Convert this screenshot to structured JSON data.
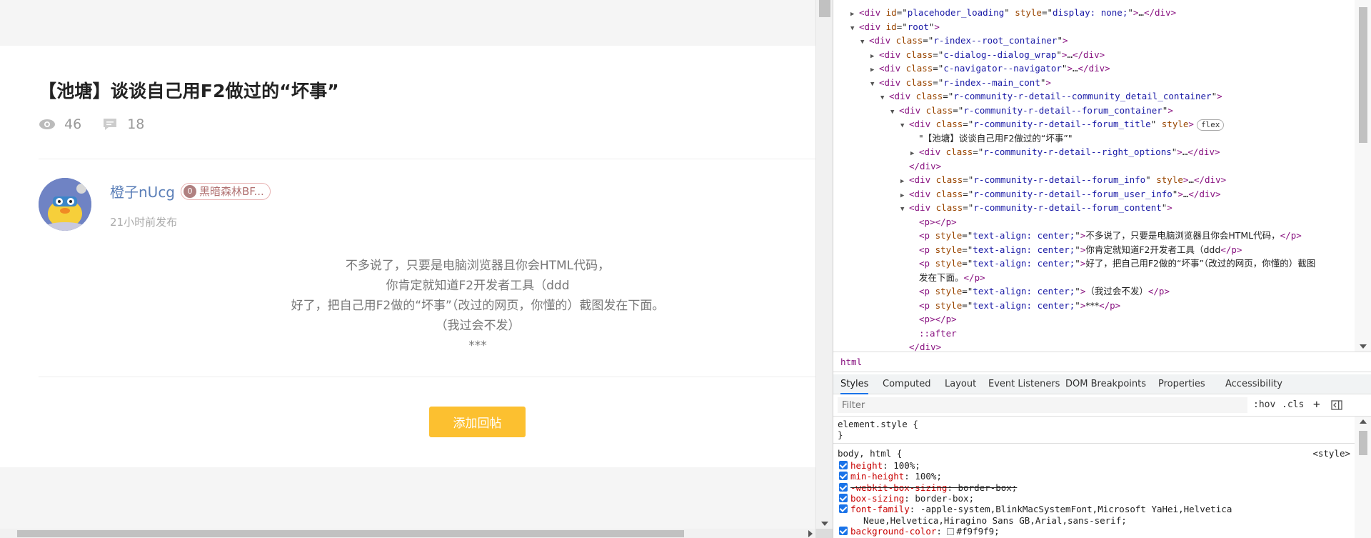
{
  "page": {
    "title": "【池塘】谈谈自己用F2做过的“坏事”",
    "views": "46",
    "comments": "18",
    "author_name": "橙子nUcg",
    "badge_level": "0",
    "badge_text": "黑暗森林BF...",
    "posted_time": "21小时前发布",
    "content_lines": [
      "不多说了，只要是电脑浏览器且你会HTML代码，",
      "你肯定就知道F2开发者工具（ddd",
      "好了，把自己用F2做的“坏事”（改过的网页，你懂的）截图发在下面。",
      "（我过会不发）",
      "***"
    ],
    "reply_button": "添加回帖"
  },
  "devtools": {
    "dom_lines": [
      {
        "indent": 0,
        "tri": "▶",
        "html": "<span class='tag'>&lt;div</span> <span class='attr'>id</span>=\"<span class='val'>placehoder_loading</span>\" <span class='attr'>style</span>=\"<span class='val'>display: none;</span>\"<span class='tag'>&gt;</span>…<span class='tag'>&lt;/div&gt;</span>"
      },
      {
        "indent": 0,
        "tri": "▼",
        "html": "<span class='tag'>&lt;div</span> <span class='attr'>id</span>=\"<span class='val'>root</span>\"<span class='tag'>&gt;</span>"
      },
      {
        "indent": 1,
        "tri": "▼",
        "html": "<span class='tag'>&lt;div</span> <span class='attr'>class</span>=\"<span class='val'>r-index--root_container</span>\"<span class='tag'>&gt;</span>"
      },
      {
        "indent": 2,
        "tri": "▶",
        "html": "<span class='tag'>&lt;div</span> <span class='attr'>class</span>=\"<span class='val'>c-dialog--dialog_wrap</span>\"<span class='tag'>&gt;</span>…<span class='tag'>&lt;/div&gt;</span>"
      },
      {
        "indent": 2,
        "tri": "▶",
        "html": "<span class='tag'>&lt;div</span> <span class='attr'>class</span>=\"<span class='val'>c-navigator--navigator</span>\"<span class='tag'>&gt;</span>…<span class='tag'>&lt;/div&gt;</span>"
      },
      {
        "indent": 2,
        "tri": "▼",
        "html": "<span class='tag'>&lt;div</span> <span class='attr'>class</span>=\"<span class='val'>r-index--main_cont</span>\"<span class='tag'>&gt;</span>"
      },
      {
        "indent": 3,
        "tri": "▼",
        "html": "<span class='tag'>&lt;div</span> <span class='attr'>class</span>=\"<span class='val'>r-community-r-detail--community_detail_container</span>\"<span class='tag'>&gt;</span>"
      },
      {
        "indent": 4,
        "tri": "▼",
        "html": "<span class='tag'>&lt;div</span> <span class='attr'>class</span>=\"<span class='val'>r-community-r-detail--forum_container</span>\"<span class='tag'>&gt;</span>"
      },
      {
        "indent": 5,
        "tri": "▼",
        "html": "<span class='tag'>&lt;div</span> <span class='attr'>class</span>=\"<span class='val'>r-community-r-detail--forum_title</span>\" <span class='attr'>style</span><span class='tag'>&gt;</span><span class='pill'>flex</span>"
      },
      {
        "indent": 6,
        "tri": "",
        "html": "<span class='txt'>\"【池塘】谈谈自己用F2做过的“坏事”\"</span>"
      },
      {
        "indent": 6,
        "tri": "▶",
        "html": "<span class='tag'>&lt;div</span> <span class='attr'>class</span>=\"<span class='val'>r-community-r-detail--right_options</span>\"<span class='tag'>&gt;</span>…<span class='tag'>&lt;/div&gt;</span>"
      },
      {
        "indent": 5,
        "tri": "",
        "html": "<span class='tag'>&lt;/div&gt;</span>"
      },
      {
        "indent": 5,
        "tri": "▶",
        "html": "<span class='tag'>&lt;div</span> <span class='attr'>class</span>=\"<span class='val'>r-community-r-detail--forum_info</span>\" <span class='attr'>style</span><span class='tag'>&gt;</span>…<span class='tag'>&lt;/div&gt;</span>"
      },
      {
        "indent": 5,
        "tri": "▶",
        "html": "<span class='tag'>&lt;div</span> <span class='attr'>class</span>=\"<span class='val'>r-community-r-detail--forum_user_info</span>\"<span class='tag'>&gt;</span>…<span class='tag'>&lt;/div&gt;</span>"
      },
      {
        "indent": 5,
        "tri": "▼",
        "html": "<span class='tag'>&lt;div</span> <span class='attr'>class</span>=\"<span class='val'>r-community-r-detail--forum_content</span>\"<span class='tag'>&gt;</span>"
      },
      {
        "indent": 6,
        "tri": "",
        "html": "<span class='tag'>&lt;p&gt;&lt;/p&gt;</span>"
      },
      {
        "indent": 6,
        "tri": "",
        "html": "<span class='tag'>&lt;p</span> <span class='attr'>style</span>=\"<span class='val'>text-align: center;</span>\"<span class='tag'>&gt;</span><span class='txt'>不多说了，只要是电脑浏览器且你会HTML代码，</span><span class='tag'>&lt;/p&gt;</span>"
      },
      {
        "indent": 6,
        "tri": "",
        "html": "<span class='tag'>&lt;p</span> <span class='attr'>style</span>=\"<span class='val'>text-align: center;</span>\"<span class='tag'>&gt;</span><span class='txt'>你肯定就知道F2开发者工具（ddd</span><span class='tag'>&lt;/p&gt;</span>"
      },
      {
        "indent": 6,
        "tri": "",
        "html": "<span class='tag'>&lt;p</span> <span class='attr'>style</span>=\"<span class='val'>text-align: center;</span>\"<span class='tag'>&gt;</span><span class='txt'>好了，把自己用F2做的“坏事”（改过的网页，你懂的）截图</span>"
      },
      {
        "indent": 6,
        "tri": "",
        "html": "<span class='txt'>发在下面。</span><span class='tag'>&lt;/p&gt;</span>"
      },
      {
        "indent": 6,
        "tri": "",
        "html": "<span class='tag'>&lt;p</span> <span class='attr'>style</span>=\"<span class='val'>text-align: center;</span>\"<span class='tag'>&gt;</span><span class='txt'>（我过会不发）</span><span class='tag'>&lt;/p&gt;</span>"
      },
      {
        "indent": 6,
        "tri": "",
        "html": "<span class='tag'>&lt;p</span> <span class='attr'>style</span>=\"<span class='val'>text-align: center;</span>\"<span class='tag'>&gt;</span><span class='txt'>***</span><span class='tag'>&lt;/p&gt;</span>"
      },
      {
        "indent": 6,
        "tri": "",
        "html": "<span class='tag'>&lt;p&gt;&lt;/p&gt;</span>"
      },
      {
        "indent": 6,
        "tri": "",
        "html": "<span class='pseudo'>::after</span>"
      },
      {
        "indent": 5,
        "tri": "",
        "html": "<span class='tag'>&lt;/div&gt;</span>"
      }
    ],
    "breadcrumb": "html",
    "tabs": [
      "Styles",
      "Computed",
      "Layout",
      "Event Listeners",
      "DOM Breakpoints",
      "Properties",
      "Accessibility"
    ],
    "filter_placeholder": "Filter",
    "filter_hov": ":hov",
    "filter_cls": ".cls",
    "filter_plus": "+",
    "element_style": "element.style {",
    "close_brace": "}",
    "rule_selector": "body, html {",
    "rule_source": "<style>",
    "props": [
      {
        "name": "height",
        "value": "100%;",
        "struck": false
      },
      {
        "name": "min-height",
        "value": "100%;",
        "struck": false
      },
      {
        "name": "-webkit-box-sizing",
        "value": "border-box;",
        "struck": true
      },
      {
        "name": "box-sizing",
        "value": "border-box;",
        "struck": false
      },
      {
        "name": "font-family",
        "value": "-apple-system,BlinkMacSystemFont,Microsoft YaHei,Helvetica",
        "struck": false
      },
      {
        "name": "",
        "value": "Neue,Helvetica,Hiragino Sans GB,Arial,sans-serif;",
        "struck": false,
        "continuation": true
      },
      {
        "name": "background-color",
        "value": "#f9f9f9;",
        "struck": false,
        "swatch": true
      }
    ]
  }
}
